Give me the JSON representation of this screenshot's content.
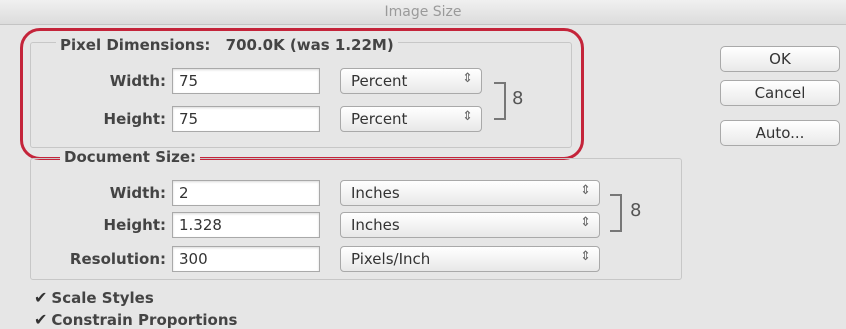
{
  "window": {
    "title": "Image Size"
  },
  "pixel_dimensions": {
    "legend": "Pixel Dimensions:",
    "size_text": "700.0K (was 1.22M)",
    "width_label": "Width:",
    "width_value": "75",
    "width_unit": "Percent",
    "height_label": "Height:",
    "height_value": "75",
    "height_unit": "Percent"
  },
  "document_size": {
    "legend": "Document Size:",
    "width_label": "Width:",
    "width_value": "2",
    "width_unit": "Inches",
    "height_label": "Height:",
    "height_value": "1.328",
    "height_unit": "Inches",
    "resolution_label": "Resolution:",
    "resolution_value": "300",
    "resolution_unit": "Pixels/Inch"
  },
  "buttons": {
    "ok": "OK",
    "cancel": "Cancel",
    "auto": "Auto..."
  },
  "options": {
    "scale_styles": {
      "label": "Scale Styles",
      "checked": true
    },
    "constrain_proportions": {
      "label": "Constrain Proportions",
      "checked": true
    }
  },
  "icons": {
    "link": "chain-link-icon",
    "check": "checkmark-icon",
    "stepper": "up-down-arrows-icon"
  },
  "colors": {
    "highlight": "#c4243a",
    "background": "#e6e6e6"
  }
}
